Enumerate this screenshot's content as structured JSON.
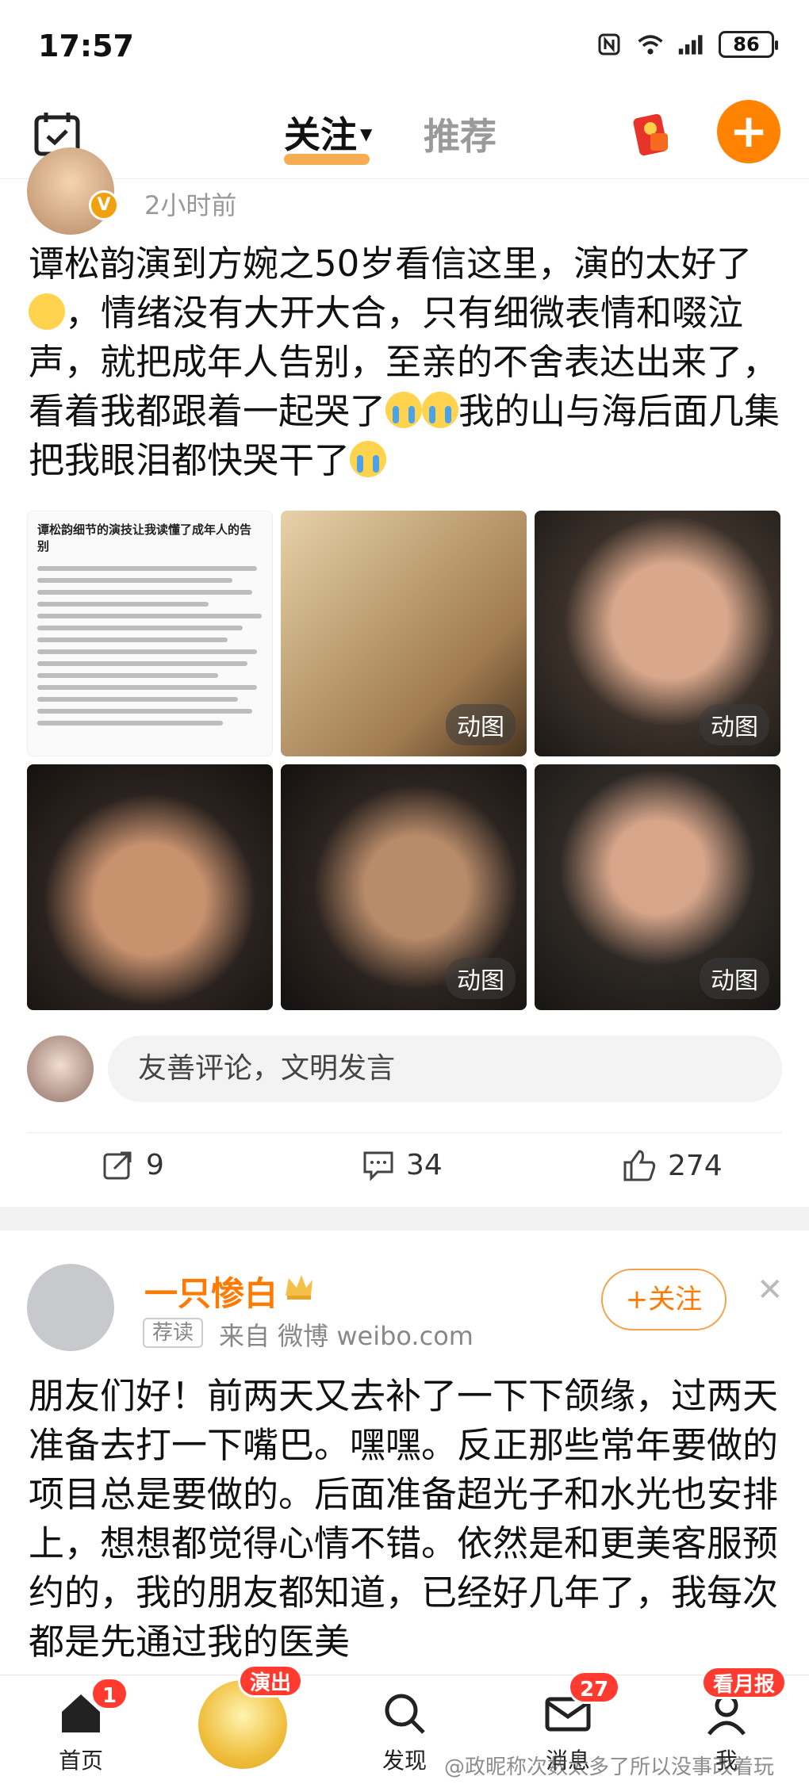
{
  "status_bar": {
    "time": "17:57",
    "battery": "86"
  },
  "top_nav": {
    "tab_follow": "关注",
    "tab_recommend": "推荐"
  },
  "post1": {
    "time_ago": "2小时前",
    "text_parts": [
      "谭松韵演到方婉之50岁看信这里，演的太好了",
      "，情绪没有大开大合，只有细微表情和啜泣声，就把成年人告别，至亲的不舍表达出来了，看着我都跟着一起哭了",
      "我的山与海后面几集把我眼泪都快哭干了"
    ],
    "image1_title": "谭松韵细节的演技让我读懂了成年人的告别",
    "gif_label": "动图",
    "comment_placeholder": "友善评论，文明发言",
    "share_count": "9",
    "comment_count": "34",
    "like_count": "274"
  },
  "post2": {
    "author": "一只惨白",
    "tag": "荐读",
    "source": "来自 微博  weibo.com",
    "follow_label": "+关注",
    "text": "朋友们好！前两天又去补了一下下颌缘，过两天准备去打一下嘴巴。嘿嘿。反正那些常年要做的项目总是要做的。后面准备超光子和水光也安排上，想想都觉得心情不错。依然是和更美客服预约的，我的朋友都知道，已经好几年了，我每次都是先通过我的医美"
  },
  "bottom_nav": {
    "home": "首页",
    "home_badge": "1",
    "live_badge": "演出",
    "discover": "发现",
    "messages": "消息",
    "messages_badge": "27",
    "me": "我",
    "me_badge": "看月报"
  },
  "watermark": "@政昵称次数太多了所以没事改着玩",
  "colors": {
    "accent": "#ff8200",
    "badge": "#ff3b30",
    "link_name": "#ff7a00"
  }
}
